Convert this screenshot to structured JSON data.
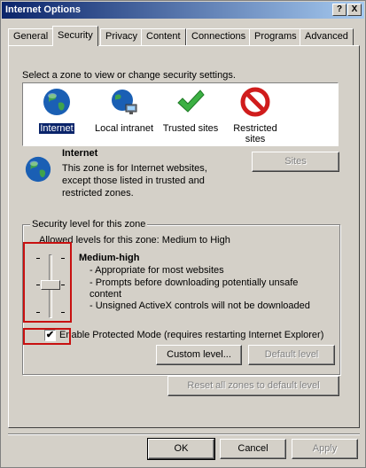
{
  "window": {
    "title": "Internet Options",
    "help_label": "?",
    "close_label": "X"
  },
  "tabs": [
    {
      "label": "General"
    },
    {
      "label": "Security"
    },
    {
      "label": "Privacy"
    },
    {
      "label": "Content"
    },
    {
      "label": "Connections"
    },
    {
      "label": "Programs"
    },
    {
      "label": "Advanced"
    }
  ],
  "zones": {
    "prompt": "Select a zone to view or change security settings.",
    "items": [
      {
        "label": "Internet",
        "icon": "globe-icon"
      },
      {
        "label": "Local intranet",
        "icon": "intranet-icon"
      },
      {
        "label": "Trusted sites",
        "icon": "checkmark-icon"
      },
      {
        "label": "Restricted sites",
        "icon": "restricted-icon"
      }
    ]
  },
  "zone_info": {
    "name": "Internet",
    "description": "This zone is for Internet websites, except those listed in trusted and restricted zones.",
    "sites_label": "Sites"
  },
  "security_level": {
    "group_title": "Security level for this zone",
    "allowed": "Allowed levels for this zone: Medium to High",
    "level_name": "Medium-high",
    "bullets": [
      "- Appropriate for most websites",
      "- Prompts before downloading potentially unsafe content",
      "- Unsigned ActiveX controls will not be downloaded"
    ],
    "protected_mode_label": "Enable Protected Mode (requires restarting Internet Explorer)",
    "protected_mode_checked": true,
    "custom_level_label": "Custom level...",
    "default_level_label": "Default level"
  },
  "reset_all_label": "Reset all zones to default level",
  "footer": {
    "ok_label": "OK",
    "cancel_label": "Cancel",
    "apply_label": "Apply"
  },
  "colors": {
    "highlight_box": "#c81010",
    "titlebar": "#0a246a",
    "face": "#d4d0c8"
  }
}
